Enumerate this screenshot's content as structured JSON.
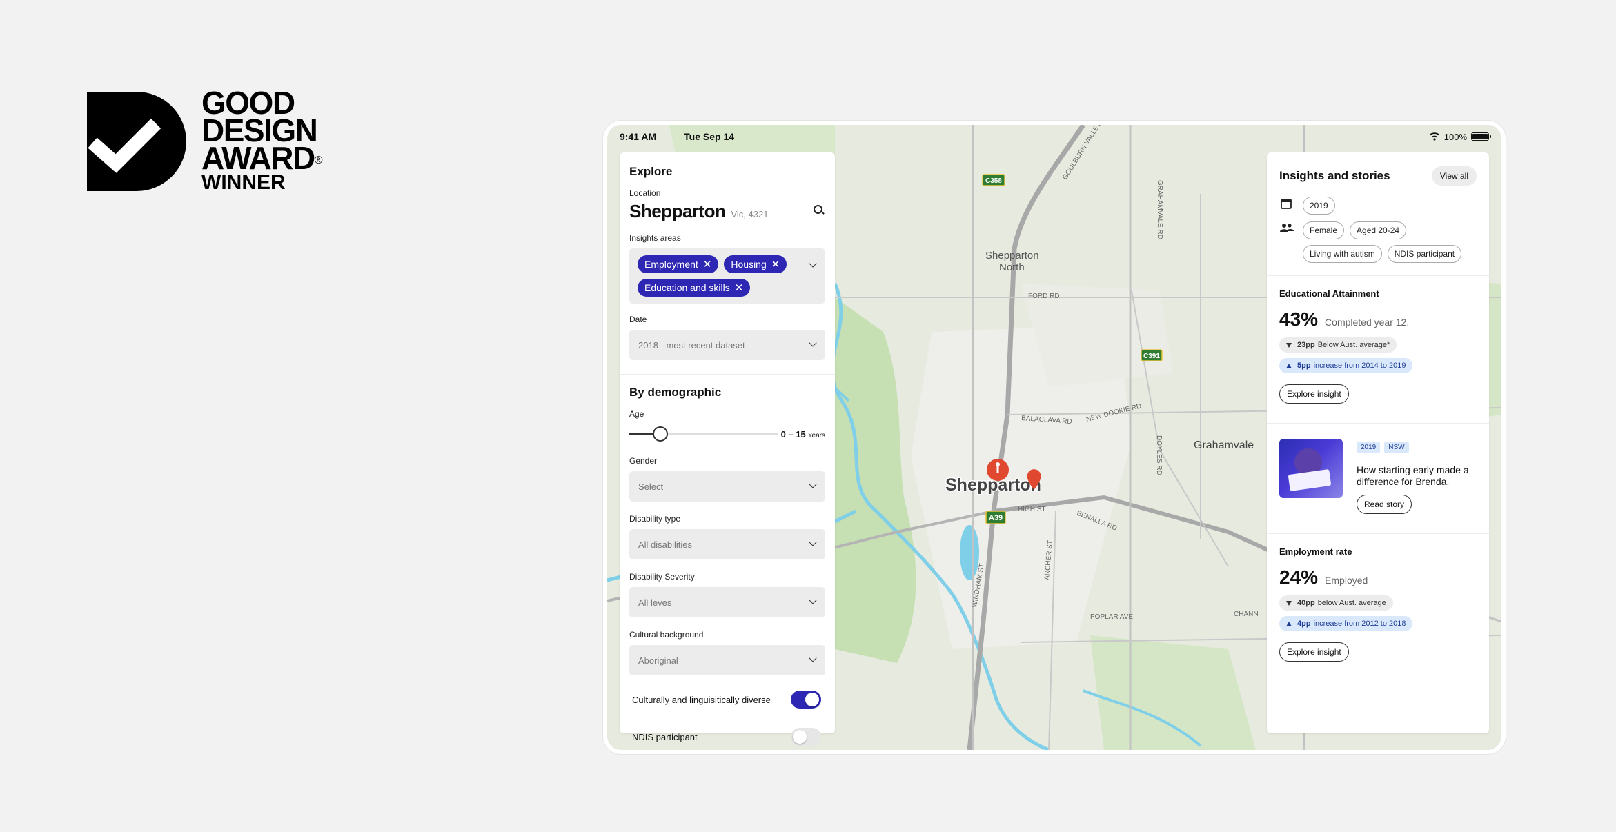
{
  "award": {
    "line1": "GOOD",
    "line2": "DESIGN",
    "line3": "AWARD",
    "registered": "®",
    "line4": "WINNER"
  },
  "statusbar": {
    "time": "9:41 AM",
    "date": "Tue Sep 14",
    "battery": "100%"
  },
  "map": {
    "labels": {
      "town": "Shepparton",
      "north": "Shepparton",
      "north2": "North",
      "grahamvale": "Grahamvale",
      "ford_rd": "FORD RD",
      "balaclava_rd": "BALACLAVA RD",
      "new_dookie_rd": "NEW DOOKIE RD",
      "high_st": "HIGH ST",
      "benalla_rd": "BENALLA RD",
      "poplar_ave": "POPLAR AVE",
      "archer_st": "ARCHER ST",
      "doyles_rd": "DOYLES RD",
      "grahamvale_rd": "GRAHAMVALE RD",
      "goulburn_valley": "GOULBURN VALLEY FWY",
      "windham_st": "WINDHAM ST",
      "channel": "CHANN"
    },
    "shields": {
      "c358": "C358",
      "c391": "C391",
      "a39": "A39"
    }
  },
  "explore": {
    "title": "Explore",
    "location_label": "Location",
    "location_name": "Shepparton",
    "location_sub": "Vic, 4321",
    "insights_label": "Insights areas",
    "chips": [
      "Employment",
      "Housing",
      "Education and skills"
    ],
    "date_label": "Date",
    "date_value": "2018 - most recent dataset",
    "demographic_title": "By demographic",
    "age_label": "Age",
    "age_value": "0 – 15",
    "age_unit": "Years",
    "age_fraction": 0.21,
    "gender_label": "Gender",
    "gender_value": "Select",
    "disability_type_label": "Disability type",
    "disability_type_value": "All disabilities",
    "disability_severity_label": "Disability Severity",
    "disability_severity_value": "All leves",
    "cultural_label": "Cultural background",
    "cultural_value": "Aboriginal",
    "cald_label": "Culturally and linguisitically diverse",
    "cald_on": true,
    "ndis_label": "NDIS participant",
    "ndis_on": false
  },
  "insights": {
    "title": "Insights and stories",
    "view_all": "View all",
    "year_tag": "2019",
    "tags": [
      "Female",
      "Aged 20-24",
      "Living with autism",
      "NDIS participant"
    ],
    "education": {
      "label": "Educational Attainment",
      "value": "43%",
      "desc": "Completed year 12.",
      "stat1_bold": "23pp",
      "stat1_text": "Below Aust. average*",
      "stat2_bold": "5pp",
      "stat2_text": "increase from 2014 to 2019",
      "button": "Explore insight"
    },
    "story": {
      "badge1": "2019",
      "badge2": "NSW",
      "title": "How starting early made a difference for Brenda.",
      "button": "Read story"
    },
    "employment": {
      "label": "Employment rate",
      "value": "24%",
      "desc": "Employed",
      "stat1_bold": "40pp",
      "stat1_text": "below Aust. average",
      "stat2_bold": "4pp",
      "stat2_text": "increase from 2012 to 2018",
      "button": "Explore insight"
    }
  },
  "colors": {
    "accent": "#2e27b3",
    "pin": "#e0482f",
    "map_land": "#e7ebdf",
    "map_park": "#c6dfb3",
    "map_water": "#7fcfe8"
  }
}
